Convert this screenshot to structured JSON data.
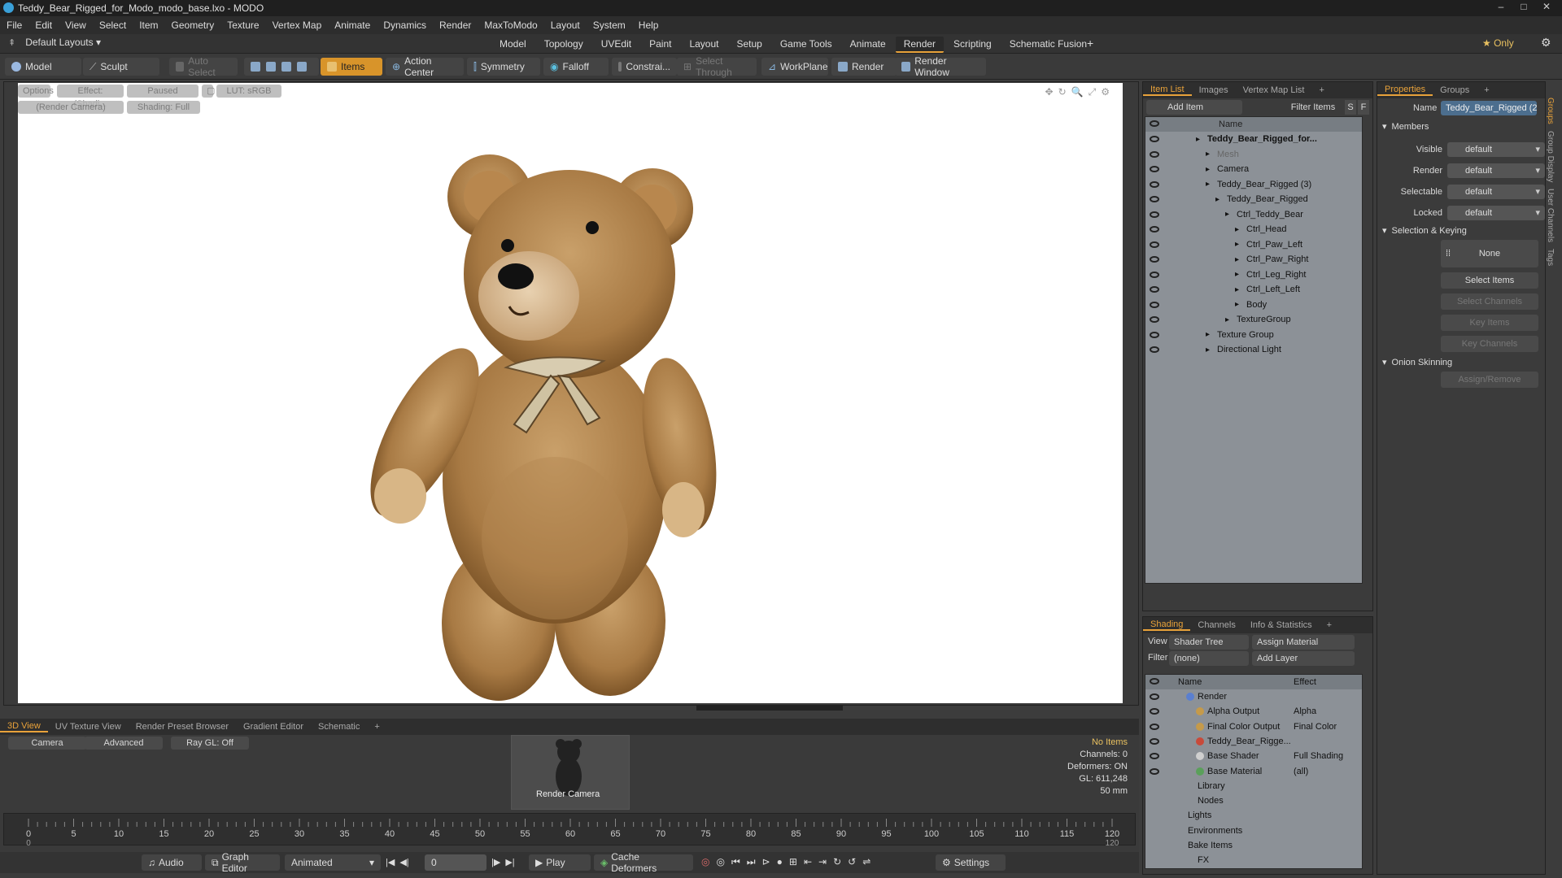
{
  "window": {
    "title": "Teddy_Bear_Rigged_for_Modo_modo_base.lxo - MODO",
    "min": "–",
    "max": "□",
    "close": "✕"
  },
  "menu": [
    "File",
    "Edit",
    "View",
    "Select",
    "Item",
    "Geometry",
    "Texture",
    "Vertex Map",
    "Animate",
    "Dynamics",
    "Render",
    "MaxToModo",
    "Layout",
    "System",
    "Help"
  ],
  "layout_bar": {
    "layout_select": "Default Layouts ▾",
    "tabs": [
      "Model",
      "Topology",
      "UVEdit",
      "Paint",
      "Layout",
      "Setup",
      "Game Tools",
      "Animate",
      "Render",
      "Scripting",
      "Schematic Fusion"
    ],
    "active_tab": "Render",
    "plus": "+",
    "only_label": "★ Only",
    "gear": "⚙"
  },
  "toolbar": {
    "model": "Model",
    "sculpt": "Sculpt",
    "auto_select": "Auto Select",
    "items": "Items",
    "action_center": "Action Center",
    "symmetry": "Symmetry",
    "falloff": "Falloff",
    "constrain": "Constrai...",
    "select_through": "Select Through",
    "workplane": "WorkPlane",
    "render": "Render",
    "render_window": "Render Window"
  },
  "viewport": {
    "options": "Options",
    "effect": "Effect: (Shadi...",
    "paused": "Paused",
    "lut": "LUT: sRGB",
    "render_camera": "(Render Camera)",
    "shading": "Shading: Full",
    "icons": [
      "✥",
      "↻",
      "🔍",
      "⤢",
      "⚙"
    ]
  },
  "item_list": {
    "tabs": [
      "Item List",
      "Images",
      "Vertex Map List",
      "+"
    ],
    "active": "Item List",
    "add_item": "Add Item",
    "filter_items": "Filter Items",
    "s": "S",
    "f": "F",
    "col_name": "Name",
    "rows": [
      {
        "label": "Teddy_Bear_Rigged_for...",
        "bold": true,
        "indent": 1
      },
      {
        "label": "Mesh",
        "dim": true,
        "indent": 2
      },
      {
        "label": "Camera",
        "indent": 2
      },
      {
        "label": "Teddy_Bear_Rigged",
        "count": "(3)",
        "indent": 2
      },
      {
        "label": "Teddy_Bear_Rigged",
        "indent": 3
      },
      {
        "label": "Ctrl_Teddy_Bear",
        "indent": 4
      },
      {
        "label": "Ctrl_Head",
        "indent": 5
      },
      {
        "label": "Ctrl_Paw_Left",
        "indent": 5
      },
      {
        "label": "Ctrl_Paw_Right",
        "indent": 5
      },
      {
        "label": "Ctrl_Leg_Right",
        "indent": 5
      },
      {
        "label": "Ctrl_Left_Left",
        "indent": 5
      },
      {
        "label": "Body",
        "indent": 5
      },
      {
        "label": "TextureGroup",
        "indent": 4
      },
      {
        "label": "Texture Group",
        "indent": 2
      },
      {
        "label": "Directional Light",
        "indent": 2
      }
    ]
  },
  "properties": {
    "tabs": [
      "Properties",
      "Groups",
      "+"
    ],
    "active": "Properties",
    "name_label": "Name",
    "name_value": "Teddy_Bear_Rigged (2",
    "members": "Members",
    "visible_label": "Visible",
    "visible": "default",
    "render_label": "Render",
    "render": "default",
    "selectable_label": "Selectable",
    "selectable": "default",
    "locked_label": "Locked",
    "locked": "default",
    "sel_keying": "Selection & Keying",
    "none": "None",
    "select_items": "Select Items",
    "select_channels": "Select Channels",
    "key_items": "Key Items",
    "key_channels": "Key Channels",
    "onion": "Onion Skinning",
    "assign_remove": "Assign/Remove",
    "side_tabs": [
      "Groups",
      "Group Display",
      "User Channels",
      "Tags"
    ]
  },
  "shading": {
    "tabs": [
      "Shading",
      "Channels",
      "Info & Statistics",
      "+"
    ],
    "active": "Shading",
    "view_label": "View",
    "view": "Shader Tree",
    "assign_material": "Assign Material",
    "filter_label": "Filter",
    "filter": "(none)",
    "add_layer": "Add Layer",
    "col_name": "Name",
    "col_effect": "Effect",
    "rows": [
      {
        "label": "Render",
        "effect": "",
        "indent": 1,
        "color": "#5a7fd0"
      },
      {
        "label": "Alpha Output",
        "effect": "Alpha",
        "indent": 2,
        "color": "#c59a4a"
      },
      {
        "label": "Final Color Output",
        "effect": "Final Color",
        "indent": 2,
        "color": "#c59a4a"
      },
      {
        "label": "Teddy_Bear_Rigge...",
        "effect": "",
        "indent": 2,
        "color": "#c84a3a"
      },
      {
        "label": "Base Shader",
        "effect": "Full Shading",
        "indent": 2,
        "color": "#cfcfcf"
      },
      {
        "label": "Base Material",
        "effect": "(all)",
        "indent": 2,
        "color": "#5aa05a"
      },
      {
        "label": "Library",
        "effect": "",
        "indent": 1,
        "color": ""
      },
      {
        "label": "Nodes",
        "effect": "",
        "indent": 1,
        "color": ""
      },
      {
        "label": "Lights",
        "effect": "",
        "indent": 0,
        "color": ""
      },
      {
        "label": "Environments",
        "effect": "",
        "indent": 0,
        "color": ""
      },
      {
        "label": "Bake Items",
        "effect": "",
        "indent": 0,
        "color": ""
      },
      {
        "label": "FX",
        "effect": "",
        "indent": 1,
        "color": ""
      }
    ]
  },
  "bottom": {
    "tabs": [
      "3D View",
      "UV Texture View",
      "Render Preset Browser",
      "Gradient Editor",
      "Schematic",
      "+"
    ],
    "active": "3D View",
    "camera": "Camera",
    "advanced": "Advanced",
    "raygl": "Ray GL: Off",
    "render_camera": "Render Camera",
    "status": {
      "no_items": "No Items",
      "channels": "Channels: 0",
      "deformers": "Deformers: ON",
      "gl": "GL: 611,248",
      "mm": "50 mm"
    }
  },
  "timeline": {
    "ticks": [
      0,
      5,
      10,
      15,
      20,
      25,
      30,
      35,
      40,
      45,
      50,
      55,
      60,
      65,
      70,
      75,
      80,
      85,
      90,
      95,
      100,
      105,
      110,
      115,
      120
    ],
    "sub_ticks": [
      0,
      120
    ]
  },
  "transport": {
    "audio": "Audio",
    "graph_editor": "Graph Editor",
    "animated": "Animated",
    "frame": "0",
    "play": "Play",
    "cache_deformers": "Cache Deformers",
    "settings": "Settings"
  }
}
